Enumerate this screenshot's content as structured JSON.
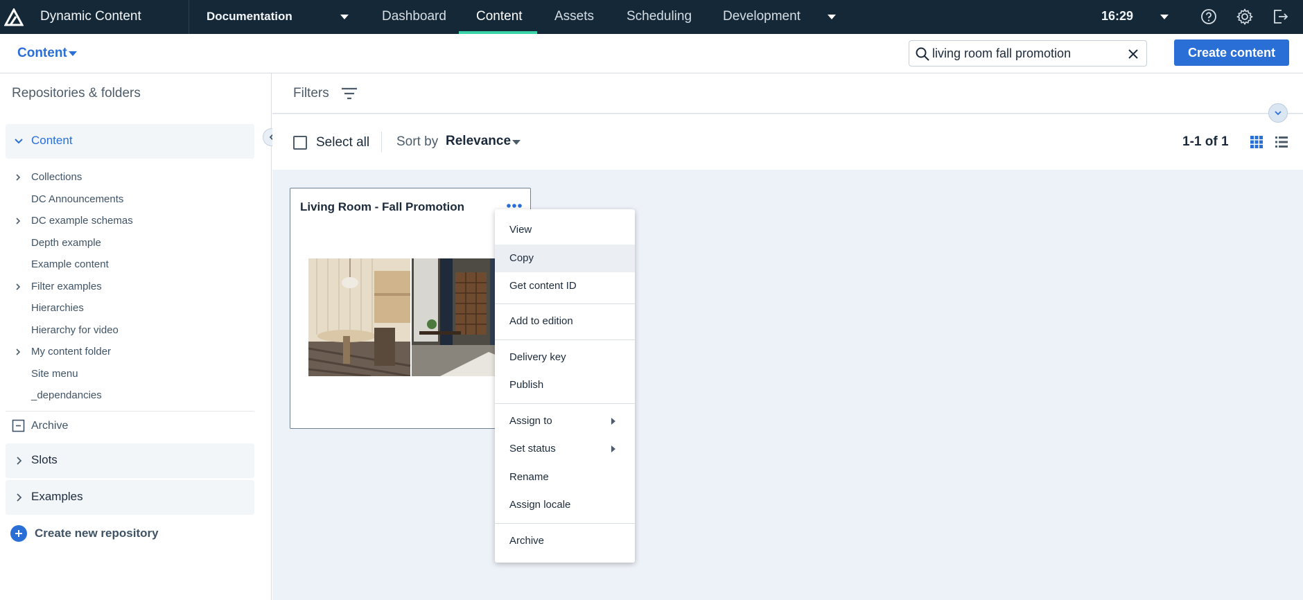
{
  "topbar": {
    "app_name": "Dynamic Content",
    "hub": "Documentation",
    "nav": [
      "Dashboard",
      "Content",
      "Assets",
      "Scheduling",
      "Development"
    ],
    "active_nav": "Content",
    "time": "16:29",
    "icons": [
      "help-icon",
      "settings-icon",
      "logout-icon"
    ]
  },
  "subbar": {
    "context": "Content",
    "search": {
      "value": "living room fall promotion",
      "placeholder": ""
    },
    "create_button": "Create content"
  },
  "sidebar": {
    "title": "Repositories & folders",
    "content_repo": "Content",
    "folders": [
      {
        "label": "Collections",
        "expandable": true
      },
      {
        "label": "DC Announcements",
        "expandable": false
      },
      {
        "label": "DC example schemas",
        "expandable": true
      },
      {
        "label": "Depth example",
        "expandable": false
      },
      {
        "label": "Example content",
        "expandable": false
      },
      {
        "label": "Filter examples",
        "expandable": true
      },
      {
        "label": "Hierarchies",
        "expandable": false
      },
      {
        "label": "Hierarchy for video",
        "expandable": false
      },
      {
        "label": "My content folder",
        "expandable": true
      },
      {
        "label": "Site menu",
        "expandable": false
      },
      {
        "label": "_dependancies",
        "expandable": false
      }
    ],
    "archive": "Archive",
    "repos": [
      "Slots",
      "Examples"
    ],
    "create_repo": "Create new repository"
  },
  "main": {
    "filters_label": "Filters",
    "select_all": "Select all",
    "sort_by_label": "Sort by",
    "sort_value": "Relevance",
    "count": "1-1 of 1"
  },
  "card": {
    "title": "Living Room - Fall Promotion"
  },
  "menu": {
    "items": [
      "View",
      "Copy",
      "Get content ID",
      "Add to edition",
      "Delivery key",
      "Publish",
      "Assign to",
      "Set status",
      "Rename",
      "Assign locale",
      "Archive"
    ],
    "highlighted": "Copy"
  },
  "colors": {
    "topbar": "#152837",
    "accent": "#2a6fd6",
    "active_underline": "#3ad3a8",
    "main_bg": "#edf2f8"
  }
}
